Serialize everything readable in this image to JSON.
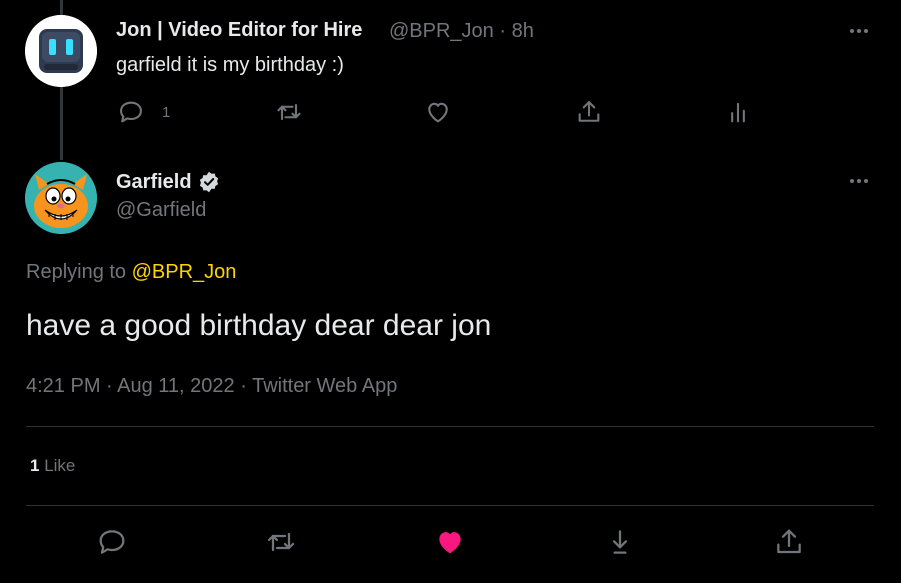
{
  "parent_tweet": {
    "display_name": "Jon | Video Editor for Hire",
    "handle_time": "@BPR_Jon · 8h",
    "text": "garfield it is my birthday :)",
    "reply_count": "1"
  },
  "main_tweet": {
    "display_name": "Garfield",
    "handle": "@Garfield",
    "replying_prefix": "Replying to ",
    "replying_handle": "@BPR_Jon",
    "text": "have a good birthday dear dear jon",
    "meta": "4:21 PM · Aug 11, 2022 · Twitter Web App",
    "like_count": "1",
    "like_label": " Like"
  },
  "colors": {
    "background": "#000000",
    "text": "#e7e9ea",
    "muted": "#71767b",
    "mention": "#ffd400",
    "liked_heart": "#f91880",
    "divider": "#2f3336"
  },
  "icons": {
    "reply": "reply-icon",
    "retweet": "retweet-icon",
    "like": "heart-icon",
    "share": "share-icon",
    "analytics": "analytics-icon",
    "bookmark": "bookmark-icon",
    "more": "more-icon",
    "verified": "verified-badge-icon"
  }
}
